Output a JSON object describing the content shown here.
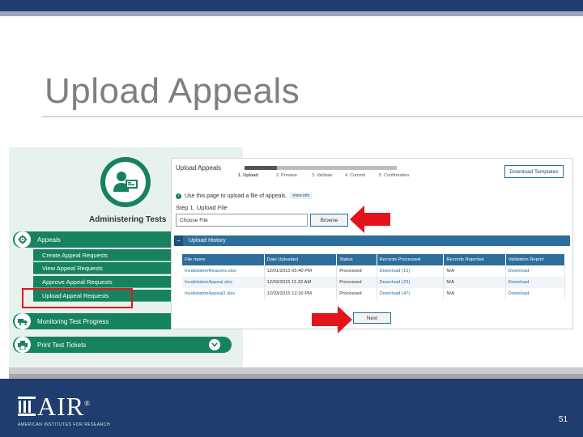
{
  "slide": {
    "title": "Upload Appeals",
    "page_number": "51"
  },
  "left_panel": {
    "title": "Administering Tests",
    "menu": {
      "appeals_label": "Appeals",
      "items": [
        {
          "label": "Create Appeal Requests"
        },
        {
          "label": "View Appeal Requests"
        },
        {
          "label": "Approve Appeal Requests"
        },
        {
          "label": "Upload Appeal Requests"
        }
      ],
      "monitoring_label": "Monitoring Test Progress",
      "print_label": "Print Test Tickets"
    }
  },
  "right_panel": {
    "title": "Upload Appeals",
    "steps": [
      "1. Upload",
      "2. Preview",
      "3. Validate",
      "4. Commit",
      "5. Confirmation"
    ],
    "download_templates_label": "Download Templates",
    "info_text": "Use this page to upload a file of appeals.",
    "more_info_label": "more info",
    "step1_label": "Step 1. Upload File",
    "file_input_value": "Choose File",
    "browse_label": "Browse",
    "history_label": "Upload History",
    "table": {
      "headers": [
        "File name",
        "Date Uploaded",
        "Status",
        "Records Processed",
        "Records Rejected",
        "Validation Report"
      ],
      "rows": [
        [
          "InvalidationReasons.xlsx",
          "12/01/2015 05:40 PM",
          "Processed",
          "Download (15)",
          "N/A",
          "Download"
        ],
        [
          "InvalidationAppeal.xlsx",
          "12/03/2015 11:32 AM",
          "Processed",
          "Download (23)",
          "N/A",
          "Download"
        ],
        [
          "InvalidationAppeal2.xlsx",
          "12/03/2015 12:10 PM",
          "Processed",
          "Download (47)",
          "N/A",
          "Download"
        ]
      ]
    },
    "next_label": "Next"
  },
  "footer": {
    "logo_text": "AIR",
    "logo_reg": "®",
    "logo_subtitle": "AMERICAN INSTITUTES FOR RESEARCH"
  },
  "colors": {
    "navy": "#1f3d6e",
    "green": "#17825e",
    "blue": "#2e6e9c",
    "red": "#e3141b"
  },
  "icons": [
    "user-monitor-icon",
    "gear-icon",
    "truck-icon",
    "printer-icon",
    "chevron-down-icon",
    "info-icon",
    "minus-icon",
    "red-arrow-icon"
  ]
}
